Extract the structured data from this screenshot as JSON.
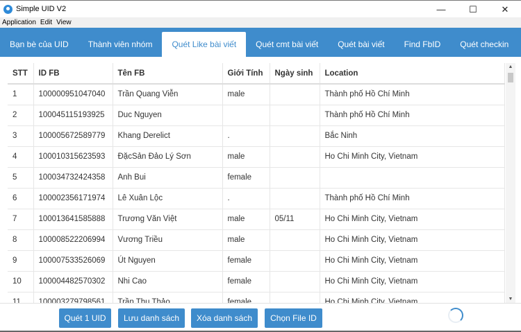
{
  "window": {
    "title": "Simple UID V2",
    "minimize": "—",
    "maximize": "☐",
    "close": "✕"
  },
  "menu": [
    "Application",
    "Edit",
    "View"
  ],
  "tabs": [
    {
      "label": "Bạn bè của UID"
    },
    {
      "label": "Thành viên nhóm"
    },
    {
      "label": "Quét Like bài viết",
      "active": true
    },
    {
      "label": "Quét cmt bài viết"
    },
    {
      "label": "Quét bài viết"
    },
    {
      "label": "Find FbID"
    },
    {
      "label": "Quét checkin"
    }
  ],
  "table": {
    "headers": [
      "STT",
      "ID FB",
      "Tên FB",
      "Giới Tính",
      "Ngày sinh",
      "Location"
    ],
    "rows": [
      [
        "1",
        "100000951047040",
        "Trần Quang Viễn",
        "male",
        "",
        "Thành phố Hồ Chí Minh"
      ],
      [
        "2",
        "100045115193925",
        "Duc Nguyen",
        "",
        "",
        "Thành phố Hồ Chí Minh"
      ],
      [
        "3",
        "100005672589779",
        "Khang Derelict",
        ".",
        "",
        "Bắc Ninh"
      ],
      [
        "4",
        "100010315623593",
        "ĐặcSản Đảo Lý Sơn",
        "male",
        "",
        "Ho Chi Minh City, Vietnam"
      ],
      [
        "5",
        "100034732424358",
        "Anh Bui",
        "female",
        "",
        ""
      ],
      [
        "6",
        "100002356171974",
        "Lê Xuân Lộc",
        ".",
        "",
        "Thành phố Hồ Chí Minh"
      ],
      [
        "7",
        "100013641585888",
        "Trương Văn Việt",
        "male",
        "05/11",
        "Ho Chi Minh City, Vietnam"
      ],
      [
        "8",
        "100008522206994",
        "Vương Triều",
        "male",
        "",
        "Ho Chi Minh City, Vietnam"
      ],
      [
        "9",
        "100007533526069",
        "Út Nguyen",
        "female",
        "",
        "Ho Chi Minh City, Vietnam"
      ],
      [
        "10",
        "100004482570302",
        "Nhi Cao",
        "female",
        "",
        "Ho Chi Minh City, Vietnam"
      ],
      [
        "11",
        "100003279798561",
        "Trần Thu Thảo",
        "female",
        "",
        "Ho Chi Minh City, Vietnam"
      ]
    ]
  },
  "buttons": {
    "scan_one": "Quét 1 UID",
    "save_list": "Lưu danh sách",
    "clear_list": "Xóa danh sách",
    "choose_file": "Chọn File ID"
  },
  "colors": {
    "accent": "#3f8ccc"
  }
}
